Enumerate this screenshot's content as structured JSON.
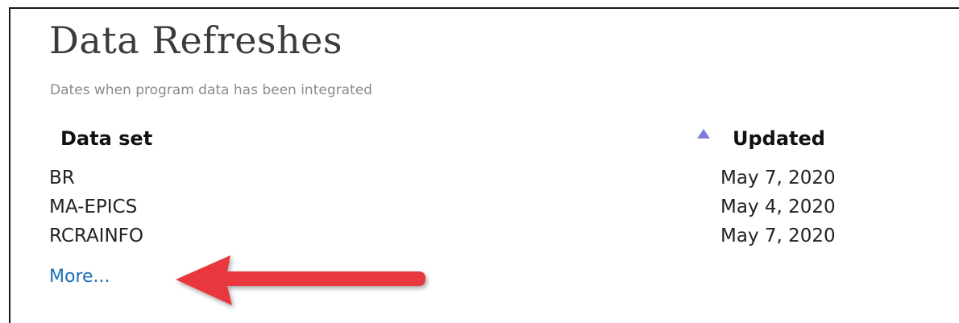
{
  "header": {
    "title": "Data Refreshes",
    "subtitle": "Dates when program data has been integrated"
  },
  "table": {
    "columns": {
      "dataset": "Data set",
      "updated": "Updated"
    },
    "sort": {
      "column": "updated",
      "direction": "ascending",
      "icon": "sort-ascending-icon"
    },
    "rows": [
      {
        "name": "BR",
        "updated": "May 7, 2020"
      },
      {
        "name": "MA-EPICS",
        "updated": "May 4, 2020"
      },
      {
        "name": "RCRAINFO",
        "updated": "May 7, 2020"
      }
    ]
  },
  "more_link": "More...",
  "annotation": {
    "icon": "red-arrow-left-icon",
    "color": "#e8383d"
  },
  "colors": {
    "sort_icon": "#7b7fd6",
    "link": "#1d6fb8",
    "title": "#3b3b3b",
    "subtitle": "#8a8a8a"
  }
}
